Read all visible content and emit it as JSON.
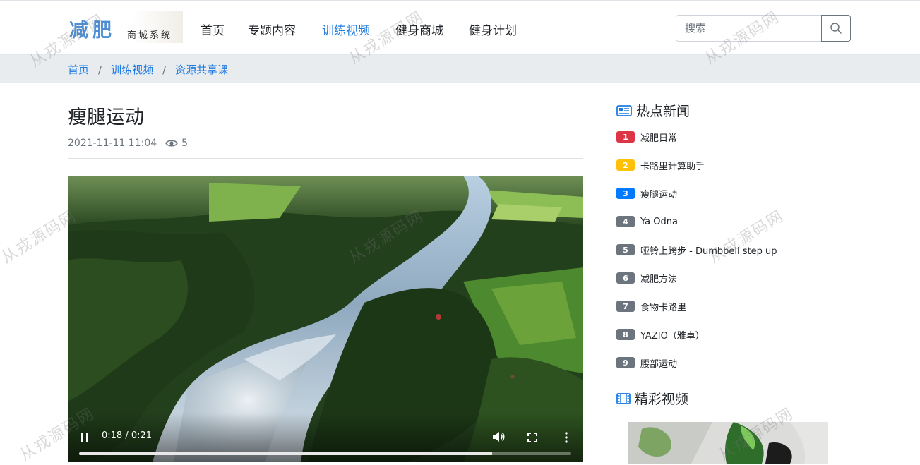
{
  "logo": {
    "main": "减肥",
    "sub": "商城系统"
  },
  "nav": [
    {
      "label": "首页",
      "active": false
    },
    {
      "label": "专题内容",
      "active": false
    },
    {
      "label": "训练视频",
      "active": true
    },
    {
      "label": "健身商城",
      "active": false
    },
    {
      "label": "健身计划",
      "active": false
    }
  ],
  "search": {
    "placeholder": "搜索",
    "icon": "search-icon"
  },
  "breadcrumb": [
    "首页",
    "训练视频",
    "资源共享课"
  ],
  "breadcrumb_separator": "/",
  "article": {
    "title": "瘦腿运动",
    "date": "2021-11-11 11:04",
    "views": "5"
  },
  "video": {
    "time": "0:18 / 0:21",
    "progress": 0.84,
    "controls": [
      "pause-icon",
      "volume-icon",
      "fullscreen-icon",
      "more-options-icon"
    ]
  },
  "sidebar": {
    "hot_news_title": "热点新闻",
    "hot_news": [
      {
        "rank": "1",
        "title": "减肥日常",
        "color": "#dc3545"
      },
      {
        "rank": "2",
        "title": "卡路里计算助手",
        "color": "#ffc107"
      },
      {
        "rank": "3",
        "title": "瘦腿运动",
        "color": "#007bff"
      },
      {
        "rank": "4",
        "title": "Ya Odna",
        "color": "#6c757d"
      },
      {
        "rank": "5",
        "title": "哑铃上跨步 - Dumbbell step up",
        "color": "#6c757d"
      },
      {
        "rank": "6",
        "title": "减肥方法",
        "color": "#6c757d"
      },
      {
        "rank": "7",
        "title": "食物卡路里",
        "color": "#6c757d"
      },
      {
        "rank": "8",
        "title": "YAZIO（雅卓）",
        "color": "#6c757d"
      },
      {
        "rank": "9",
        "title": "腰部运动",
        "color": "#6c757d"
      }
    ],
    "videos_title": "精彩视频"
  },
  "watermark": "从戎源码网",
  "colors": {
    "accent": "#1e7be0",
    "breadcrumb_bg": "#e9ecef"
  }
}
